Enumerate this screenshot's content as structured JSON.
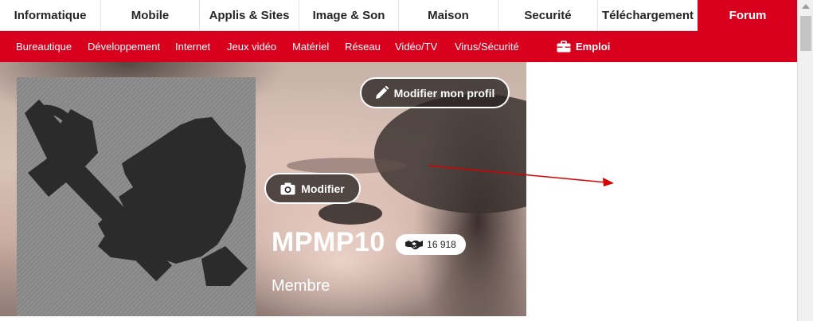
{
  "top_nav": {
    "tabs": [
      {
        "label": "Informatique",
        "active": false
      },
      {
        "label": "Mobile",
        "active": false
      },
      {
        "label": "Applis & Sites",
        "active": false
      },
      {
        "label": "Image & Son",
        "active": false
      },
      {
        "label": "Maison",
        "active": false
      },
      {
        "label": "Securité",
        "active": false
      },
      {
        "label": "Téléchargement",
        "active": false
      },
      {
        "label": "Forum",
        "active": true
      }
    ]
  },
  "sub_nav": {
    "items": [
      {
        "label": "Bureautique"
      },
      {
        "label": "Développement"
      },
      {
        "label": "Internet"
      },
      {
        "label": "Jeux vidéo"
      },
      {
        "label": "Matériel"
      },
      {
        "label": "Réseau"
      },
      {
        "label": "Vidéo/TV"
      },
      {
        "label": "Virus/Sécurité"
      }
    ],
    "emploi": {
      "label": "Emploi",
      "icon": "briefcase-icon"
    }
  },
  "profile": {
    "edit_profile_label": "Modifier mon profil",
    "edit_profile_icon": "pencil-icon",
    "modify_photo_label": "Modifier",
    "modify_photo_icon": "camera-icon",
    "username": "MPMP10",
    "reputation_count": "16 918",
    "reputation_icon": "handshake-icon",
    "role": "Membre",
    "avatar_icon": "wrench-hand-icon"
  },
  "colors": {
    "brand_red": "#d9001d",
    "annotation_arrow": "#d60000"
  }
}
